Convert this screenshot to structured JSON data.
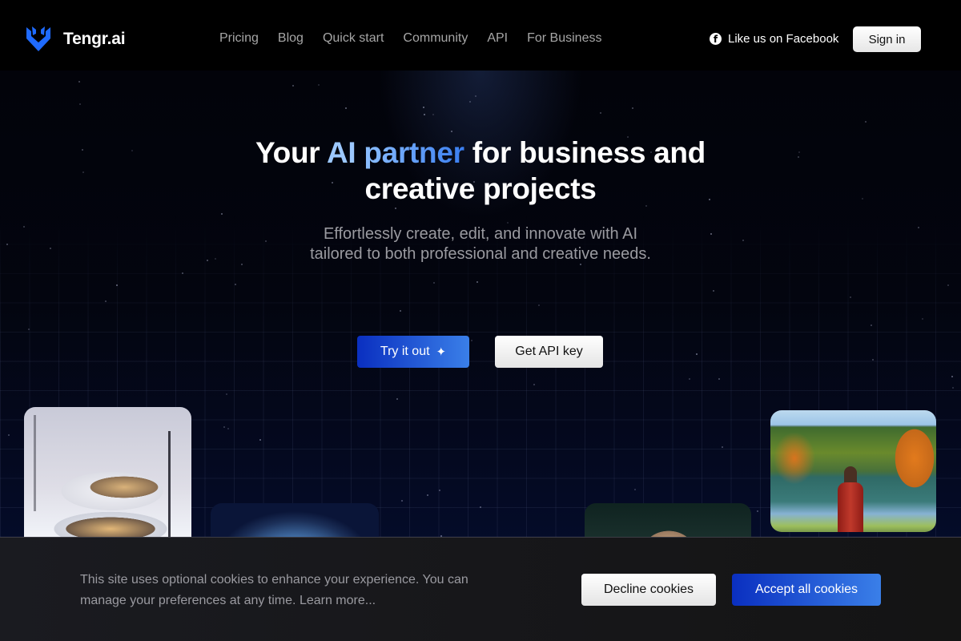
{
  "header": {
    "brand": "Tengr.ai",
    "logo_icon": "antler-shield-logo",
    "brand_color": "#1f6bff",
    "nav": [
      {
        "label": "Pricing"
      },
      {
        "label": "Blog"
      },
      {
        "label": "Quick start"
      },
      {
        "label": "Community"
      },
      {
        "label": "API"
      },
      {
        "label": "For Business"
      }
    ],
    "facebook": {
      "icon": "facebook-icon",
      "label": "Like us on Facebook"
    },
    "sign_in": "Sign in"
  },
  "hero": {
    "headline": {
      "part1": "Your ",
      "ai": "AI",
      "space": " ",
      "partner": "partner",
      "part2": " for business and",
      "line2": "creative projects"
    },
    "subtitle": "Effortlessly create, edit, and innovate with AI tailored to both professional and creative needs.",
    "try_button": "Try it out",
    "try_icon": "sparkle-icon",
    "api_button": "Get API key",
    "accent_gradient": [
      "#0a2fc0",
      "#3a7fe8"
    ],
    "images": [
      {
        "name": "snowy-modern-house"
      },
      {
        "name": "hooded-figure"
      },
      {
        "name": "girl-with-flower-wreath"
      },
      {
        "name": "woman-red-coat-autumn-lake"
      }
    ]
  },
  "cookie_banner": {
    "text": "This site uses optional cookies to enhance your experience. You can manage your preferences at any time.",
    "learn_more": "Learn more...",
    "decline": "Decline cookies",
    "accept": "Accept all cookies"
  }
}
